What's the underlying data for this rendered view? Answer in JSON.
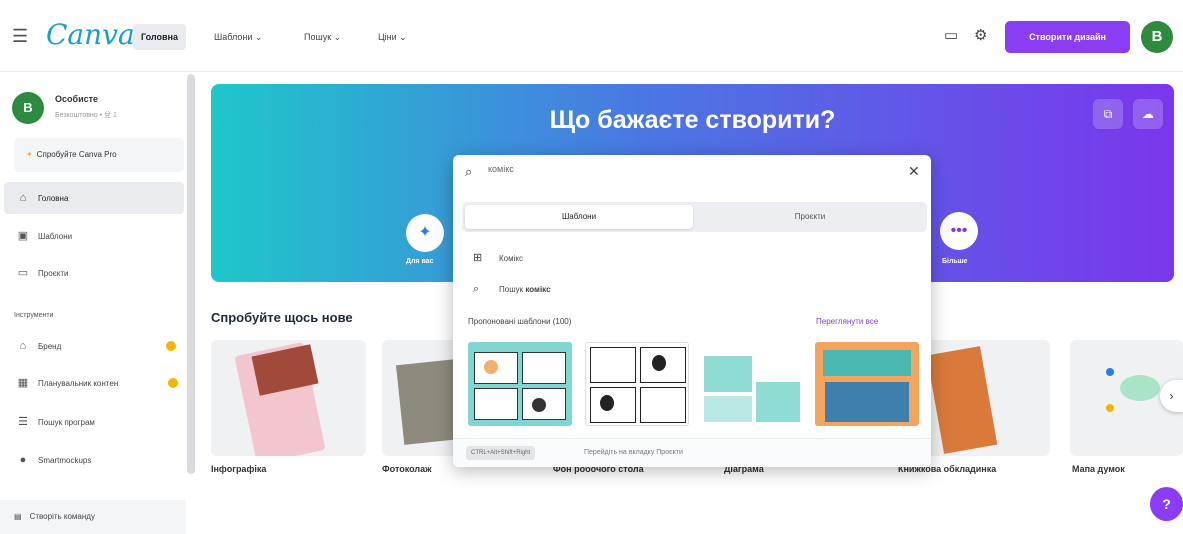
{
  "topbar": {
    "logo": "Canva",
    "nav": [
      "Головна",
      "Шаблони ⌄",
      "Пошук ⌄",
      "Ціни ⌄"
    ],
    "create_button": "Створити дизайн",
    "avatar_initial": "B"
  },
  "sidebar": {
    "account_initial": "B",
    "account_name": "Особисте",
    "account_sub": "Безкоштовно • 兌 1",
    "pro_label": "Спробуйте Canva Pro",
    "items": [
      {
        "label": "Головна",
        "icon": "home-icon"
      },
      {
        "label": "Шаблони",
        "icon": "template-icon"
      },
      {
        "label": "Проєкти",
        "icon": "folder-icon"
      }
    ],
    "tools_heading": "Інструменти",
    "tools": [
      {
        "label": "Бренд",
        "icon": "brand-icon"
      },
      {
        "label": "Планувальник контен",
        "icon": "calendar-icon"
      },
      {
        "label": "Пошук програм",
        "icon": "apps-icon"
      },
      {
        "label": "Smartmockups",
        "icon": "mockup-icon"
      }
    ],
    "bottom_label": "Створіть команду"
  },
  "hero": {
    "title": "Що бажаєте створити?",
    "left_label": "Для вас",
    "right_label": "Більше"
  },
  "section": {
    "title": "Спробуйте щось нове",
    "cards": [
      "Інфографіка",
      "Фотоколаж",
      "Фон робочого стола",
      "Діаграма",
      "Книжкова обкладинка",
      "Мапа думок"
    ]
  },
  "search": {
    "value": "комікс",
    "tabs": [
      "Шаблони",
      "Проєкти"
    ],
    "results": [
      {
        "label": "Комікс",
        "icon": "grid-icon"
      },
      {
        "prefix": "Пошук ",
        "bold": "комікс",
        "icon": "search-icon"
      }
    ],
    "suggested_label": "Пропоновані шаблони (100)",
    "see_all": "Переглянути все",
    "footer_shortcut": "CTRL+Alt+Shift+Right",
    "footer_text": "Перейдіть на вкладку Проєкти"
  },
  "colors": {
    "accent": "#8b3df5",
    "avatar": "#2d8a3e",
    "hero_start": "#1ec7c9",
    "hero_end": "#7a36ec"
  }
}
